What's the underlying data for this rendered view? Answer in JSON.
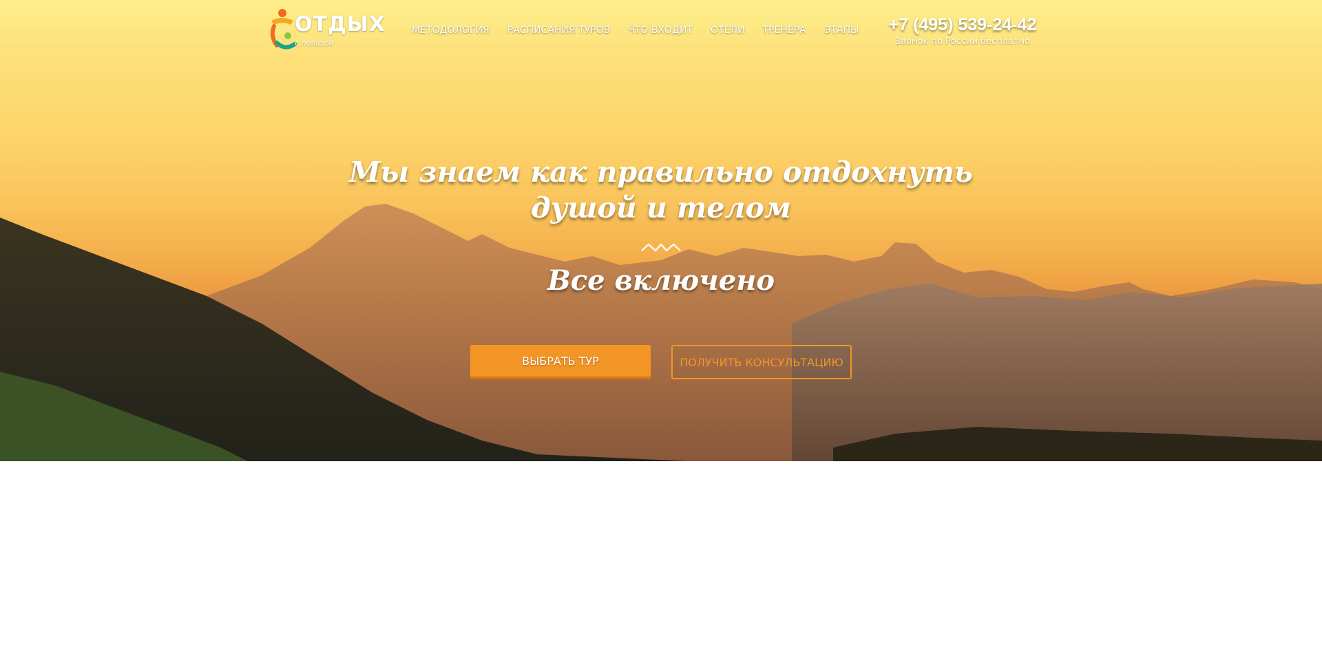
{
  "header": {
    "logo": {
      "word": "ОТДЫХ",
      "sub": "с пользой"
    },
    "nav": [
      "МЕТОДОЛОГИЯ",
      "РАСПИСАНИЯ ТУРОВ",
      "ЧТО ВХОДИТ",
      "ОТЕЛИ",
      "ТРЕНЕРА",
      "ЭТАПЫ"
    ],
    "phone": "+7 (495) 539-24-42",
    "phone_note": "Звонок по России бесплатно"
  },
  "hero": {
    "headline": "Мы знаем как правильно отдохнуть душой и телом",
    "subhead": "Все включено",
    "primary_button": "ВЫБРАТЬ ТУР",
    "secondary_button": "ПОЛУЧИТЬ КОНСУЛЬТАЦИЮ"
  },
  "colors": {
    "accent": "#f39524",
    "text_light": "#ffffff"
  },
  "icons": [
    "logo-figures-icon",
    "zigzag-divider-icon"
  ]
}
